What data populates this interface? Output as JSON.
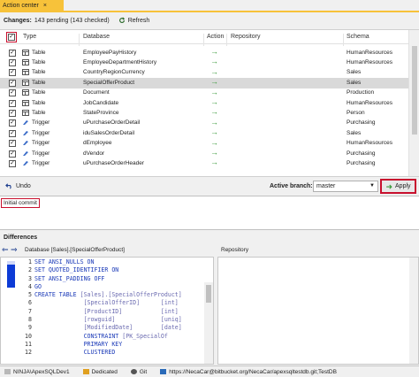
{
  "tab": {
    "title": "Action center",
    "close": "×"
  },
  "changes": {
    "label": "Changes:",
    "summary": "143 pending (143 checked)",
    "refresh": "Refresh"
  },
  "columns": {
    "type": "Type",
    "database": "Database",
    "action": "Action",
    "repository": "Repository",
    "schema": "Schema"
  },
  "rows": [
    {
      "checked": "✓",
      "type": "Table",
      "name": "EmployeePayHistory",
      "action": "→",
      "schema": "HumanResources",
      "selected": false
    },
    {
      "checked": "✓",
      "type": "Table",
      "name": "EmployeeDepartmentHistory",
      "action": "→",
      "schema": "HumanResources",
      "selected": false
    },
    {
      "checked": "✓",
      "type": "Table",
      "name": "CountryRegionCurrency",
      "action": "→",
      "schema": "Sales",
      "selected": false
    },
    {
      "checked": "✓",
      "type": "Table",
      "name": "SpecialOfferProduct",
      "action": "→",
      "schema": "Sales",
      "selected": true
    },
    {
      "checked": "✓",
      "type": "Table",
      "name": "Document",
      "action": "→",
      "schema": "Production",
      "selected": false
    },
    {
      "checked": "✓",
      "type": "Table",
      "name": "JobCandidate",
      "action": "→",
      "schema": "HumanResources",
      "selected": false
    },
    {
      "checked": "✓",
      "type": "Table",
      "name": "StateProvince",
      "action": "→",
      "schema": "Person",
      "selected": false
    },
    {
      "checked": "✓",
      "type": "Trigger",
      "name": "uPurchaseOrderDetail",
      "action": "→",
      "schema": "Purchasing",
      "selected": false
    },
    {
      "checked": "✓",
      "type": "Trigger",
      "name": "iduSalesOrderDetail",
      "action": "→",
      "schema": "Sales",
      "selected": false
    },
    {
      "checked": "✓",
      "type": "Trigger",
      "name": "dEmployee",
      "action": "→",
      "schema": "HumanResources",
      "selected": false
    },
    {
      "checked": "✓",
      "type": "Trigger",
      "name": "dVendor",
      "action": "→",
      "schema": "Purchasing",
      "selected": false
    },
    {
      "checked": "✓",
      "type": "Trigger",
      "name": "uPurchaseOrderHeader",
      "action": "→",
      "schema": "Purchasing",
      "selected": false
    }
  ],
  "toolbar": {
    "undo": "Undo",
    "active_branch_label": "Active branch:",
    "branch": "master",
    "apply": "Apply"
  },
  "commit": {
    "message": "Initial commit"
  },
  "differences": {
    "title": "Differences",
    "left_header": "Database [Sales].[SpecialOfferProduct]",
    "right_header": "Repository",
    "lines": [
      {
        "n": "1",
        "parts": [
          [
            "kw",
            "SET ANSI_NULLS ON"
          ]
        ]
      },
      {
        "n": "2",
        "parts": [
          [
            "kw",
            "SET QUOTED_IDENTIFIER ON"
          ]
        ]
      },
      {
        "n": "3",
        "parts": [
          [
            "kw",
            "SET ANSI_PADDING OFF"
          ]
        ]
      },
      {
        "n": "4",
        "parts": [
          [
            "kw",
            "GO"
          ]
        ]
      },
      {
        "n": "5",
        "parts": [
          [
            "kw",
            "CREATE TABLE "
          ],
          [
            "ty",
            "[Sales].[SpecialOfferProduct]"
          ]
        ]
      },
      {
        "n": "6",
        "parts": [
          [
            "ty",
            "              [SpecialOfferID]      [int]"
          ]
        ]
      },
      {
        "n": "7",
        "parts": [
          [
            "ty",
            "              [ProductID]           [int]"
          ]
        ]
      },
      {
        "n": "8",
        "parts": [
          [
            "ty",
            "              [rowguid]             [uniq]"
          ]
        ]
      },
      {
        "n": "9",
        "parts": [
          [
            "ty",
            "              [ModifiedDate]        [date]"
          ]
        ]
      },
      {
        "n": "10",
        "parts": [
          [
            "kw",
            "              CONSTRAINT "
          ],
          [
            "ty",
            "[PK_SpecialOf"
          ]
        ]
      },
      {
        "n": "11",
        "parts": [
          [
            "kw",
            "              PRIMARY KEY"
          ]
        ]
      },
      {
        "n": "12",
        "parts": [
          [
            "kw",
            "              CLUSTERED"
          ]
        ]
      }
    ]
  },
  "status": {
    "server": "NINJA\\ApexSQLDev1",
    "mode": "Dedicated",
    "vcs": "Git",
    "url": "https://NecaCar@bitbucket.org/NecaCar/apexsqltestdb.git;TestDB"
  },
  "colors": {
    "accent": "#f7c23a",
    "highlight": "#c8102e",
    "arrow": "#3a9a3a",
    "keyword": "#1b3ab8"
  }
}
